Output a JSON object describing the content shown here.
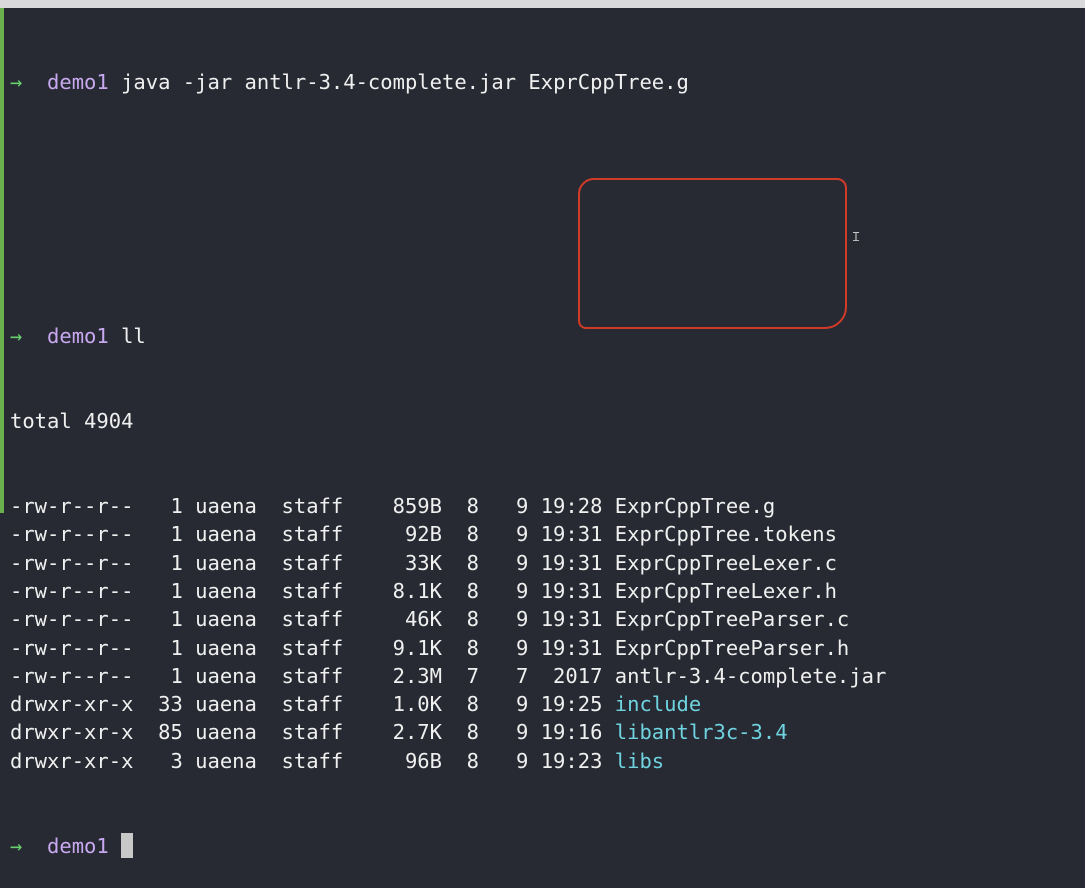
{
  "prompt_dir": "demo1",
  "commands": {
    "first": "java -jar antlr-3.4-complete.jar ExprCppTree.g",
    "second": "ll"
  },
  "total": "total 4904",
  "files": [
    {
      "perm": "-rw-r--r--",
      "links": "1",
      "owner": "uaena",
      "group": "staff",
      "size": "859B",
      "month": "8",
      "day": "9",
      "time": "19:28",
      "name": "ExprCppTree.g",
      "kind": "file"
    },
    {
      "perm": "-rw-r--r--",
      "links": "1",
      "owner": "uaena",
      "group": "staff",
      "size": "92B",
      "month": "8",
      "day": "9",
      "time": "19:31",
      "name": "ExprCppTree.tokens",
      "kind": "file"
    },
    {
      "perm": "-rw-r--r--",
      "links": "1",
      "owner": "uaena",
      "group": "staff",
      "size": "33K",
      "month": "8",
      "day": "9",
      "time": "19:31",
      "name": "ExprCppTreeLexer.c",
      "kind": "file"
    },
    {
      "perm": "-rw-r--r--",
      "links": "1",
      "owner": "uaena",
      "group": "staff",
      "size": "8.1K",
      "month": "8",
      "day": "9",
      "time": "19:31",
      "name": "ExprCppTreeLexer.h",
      "kind": "file"
    },
    {
      "perm": "-rw-r--r--",
      "links": "1",
      "owner": "uaena",
      "group": "staff",
      "size": "46K",
      "month": "8",
      "day": "9",
      "time": "19:31",
      "name": "ExprCppTreeParser.c",
      "kind": "file"
    },
    {
      "perm": "-rw-r--r--",
      "links": "1",
      "owner": "uaena",
      "group": "staff",
      "size": "9.1K",
      "month": "8",
      "day": "9",
      "time": "19:31",
      "name": "ExprCppTreeParser.h",
      "kind": "file"
    },
    {
      "perm": "-rw-r--r--",
      "links": "1",
      "owner": "uaena",
      "group": "staff",
      "size": "2.3M",
      "month": "7",
      "day": "7",
      "time": "2017",
      "name": "antlr-3.4-complete.jar",
      "kind": "file"
    },
    {
      "perm": "drwxr-xr-x",
      "links": "33",
      "owner": "uaena",
      "group": "staff",
      "size": "1.0K",
      "month": "8",
      "day": "9",
      "time": "19:25",
      "name": "include",
      "kind": "dir"
    },
    {
      "perm": "drwxr-xr-x",
      "links": "85",
      "owner": "uaena",
      "group": "staff",
      "size": "2.7K",
      "month": "8",
      "day": "9",
      "time": "19:16",
      "name": "libantlr3c-3.4",
      "kind": "dir"
    },
    {
      "perm": "drwxr-xr-x",
      "links": "3",
      "owner": "uaena",
      "group": "staff",
      "size": "96B",
      "month": "8",
      "day": "9",
      "time": "19:23",
      "name": "libs",
      "kind": "dir"
    }
  ],
  "icons": {
    "prompt_arrow": "→",
    "prompt_arrow_name": "prompt-arrow-icon",
    "mouse_cursor_name": "ibeam-cursor-icon"
  },
  "colors": {
    "background": "#272a32",
    "prompt_arrow": "#69d06e",
    "prompt_dir": "#c8a8f0",
    "directory_name": "#6fd3e0",
    "highlight": "#d23a28"
  }
}
